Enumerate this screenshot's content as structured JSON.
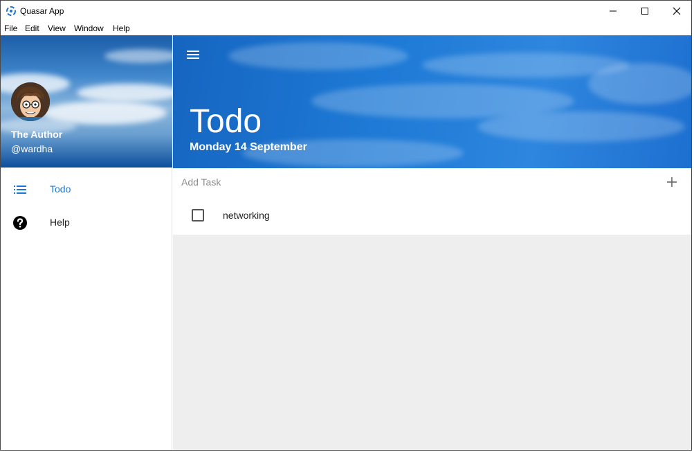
{
  "window": {
    "title": "Quasar App",
    "controls": {
      "minimize": "minimize",
      "maximize": "maximize",
      "close": "close"
    }
  },
  "menubar": [
    "File",
    "Edit",
    "View",
    "Window",
    "Help"
  ],
  "drawer": {
    "author_name": "The Author",
    "author_handle": "@wardha",
    "nav": [
      {
        "label": "Todo",
        "icon": "list-icon",
        "active": true
      },
      {
        "label": "Help",
        "icon": "help-circle-icon",
        "active": false
      }
    ]
  },
  "header": {
    "title": "Todo",
    "date": "Monday 14 September"
  },
  "add_task": {
    "placeholder": "Add Task",
    "value": ""
  },
  "tasks": [
    {
      "label": "networking",
      "done": false
    }
  ],
  "colors": {
    "accent": "#1976d2",
    "header_blue": "#1e7ad6",
    "page_bg": "#eeeeee"
  }
}
